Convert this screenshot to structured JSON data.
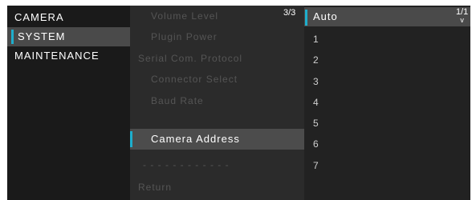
{
  "categories": [
    {
      "label": "CAMERA"
    },
    {
      "label": "SYSTEM"
    },
    {
      "label": "MAINTENANCE"
    }
  ],
  "menu": {
    "page": "3/3",
    "items": [
      {
        "label": "Volume Level"
      },
      {
        "label": "Plugin Power"
      },
      {
        "label": "Serial Com. Protocol"
      },
      {
        "label": "Connector Select"
      },
      {
        "label": "Baud Rate"
      },
      {
        "label": "Camera Address"
      },
      {
        "label": "- - - - - - - - - - - -"
      },
      {
        "label": "Return"
      }
    ]
  },
  "options": {
    "page": "1/1",
    "items": [
      {
        "label": "Auto"
      },
      {
        "label": "1"
      },
      {
        "label": "2"
      },
      {
        "label": "3"
      },
      {
        "label": "4"
      },
      {
        "label": "5"
      },
      {
        "label": "6"
      },
      {
        "label": "7"
      }
    ]
  },
  "colors": {
    "accent": "#1eaecc",
    "selected_bg": "#4a4a4a",
    "dimmed_text": "#555555"
  },
  "icons": {
    "page_scroll_down": "chevron-down-icon"
  }
}
